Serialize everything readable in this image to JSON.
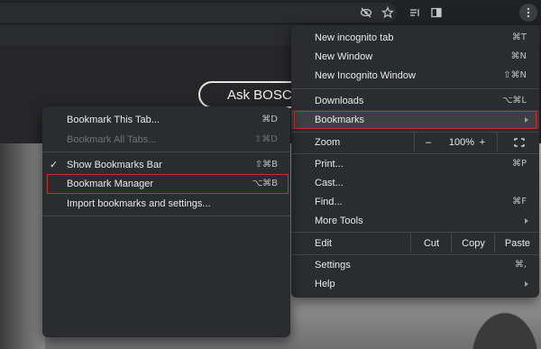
{
  "browser": {
    "toolbar_icons": [
      "eye-off-icon",
      "star-icon",
      "reading-list-icon",
      "side-panel-icon",
      "more-vert-icon"
    ]
  },
  "page": {
    "ask_button_label": "Ask BOSC"
  },
  "chrome_menu": {
    "items": {
      "new_incognito_tab": {
        "label": "New incognito tab",
        "shortcut": "⌘T"
      },
      "new_window": {
        "label": "New Window",
        "shortcut": "⌘N"
      },
      "new_incognito_window": {
        "label": "New Incognito Window",
        "shortcut": "⇧⌘N"
      },
      "downloads": {
        "label": "Downloads",
        "shortcut": "⌥⌘L"
      },
      "bookmarks": {
        "label": "Bookmarks"
      },
      "zoom": {
        "label": "Zoom",
        "minus": "–",
        "level": "100%",
        "plus": "+"
      },
      "print": {
        "label": "Print...",
        "shortcut": "⌘P"
      },
      "cast": {
        "label": "Cast..."
      },
      "find": {
        "label": "Find...",
        "shortcut": "⌘F"
      },
      "more_tools": {
        "label": "More Tools"
      },
      "edit": {
        "label": "Edit",
        "cut": "Cut",
        "copy": "Copy",
        "paste": "Paste"
      },
      "settings": {
        "label": "Settings",
        "shortcut": "⌘,"
      },
      "help": {
        "label": "Help"
      }
    }
  },
  "bookmarks_submenu": {
    "items": {
      "bookmark_this_tab": {
        "label": "Bookmark This Tab...",
        "shortcut": "⌘D"
      },
      "bookmark_all_tabs": {
        "label": "Bookmark All Tabs...",
        "shortcut": "⇧⌘D"
      },
      "show_bookmarks_bar": {
        "label": "Show Bookmarks Bar",
        "shortcut": "⇧⌘B",
        "check": "✓"
      },
      "bookmark_manager": {
        "label": "Bookmark Manager",
        "shortcut": "⌥⌘B"
      },
      "import_bookmarks": {
        "label": "Import bookmarks and settings..."
      }
    }
  },
  "colors": {
    "menu_bg": "#2b2c2f",
    "highlight_border": "#c4312b",
    "text": "#e8eaed",
    "disabled_text": "#6f7276"
  }
}
